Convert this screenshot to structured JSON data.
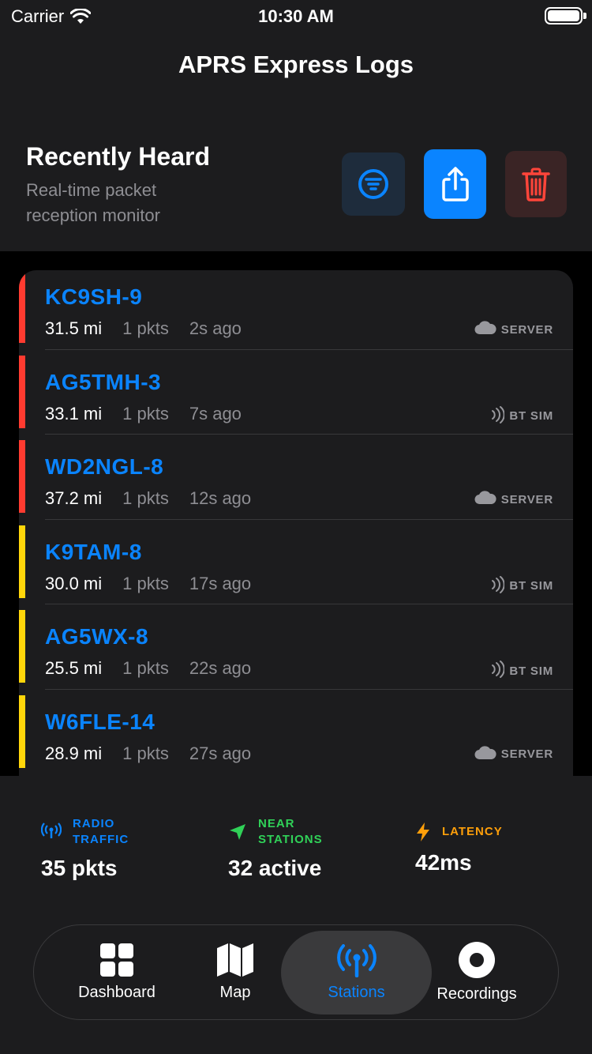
{
  "status_bar": {
    "carrier": "Carrier",
    "time": "10:30 AM"
  },
  "app_title": "APRS Express Logs",
  "section": {
    "title": "Recently Heard",
    "subtitle": "Real-time packet reception monitor"
  },
  "header_buttons": {
    "filter": "filter-icon",
    "share": "share-icon",
    "delete": "trash-icon"
  },
  "colors": {
    "accent": "#0a84ff",
    "red": "#ff3b30",
    "yellow": "#ffd60a",
    "green": "#30d158",
    "orange": "#ff9f0a"
  },
  "stations": [
    {
      "callsign": "KC9SH-9",
      "distance": "31.5 mi",
      "packets": "1 pkts",
      "ago": "2s ago",
      "source": "SERVER",
      "source_icon": "cloud-icon",
      "status_color": "#ff3b30"
    },
    {
      "callsign": "AG5TMH-3",
      "distance": "33.1 mi",
      "packets": "1 pkts",
      "ago": "7s ago",
      "source": "BT SIM",
      "source_icon": "bluetooth-waves-icon",
      "status_color": "#ff3b30"
    },
    {
      "callsign": "WD2NGL-8",
      "distance": "37.2 mi",
      "packets": "1 pkts",
      "ago": "12s ago",
      "source": "SERVER",
      "source_icon": "cloud-icon",
      "status_color": "#ff3b30"
    },
    {
      "callsign": "K9TAM-8",
      "distance": "30.0 mi",
      "packets": "1 pkts",
      "ago": "17s ago",
      "source": "BT SIM",
      "source_icon": "bluetooth-waves-icon",
      "status_color": "#ffd60a"
    },
    {
      "callsign": "AG5WX-8",
      "distance": "25.5 mi",
      "packets": "1 pkts",
      "ago": "22s ago",
      "source": "BT SIM",
      "source_icon": "bluetooth-waves-icon",
      "status_color": "#ffd60a"
    },
    {
      "callsign": "W6FLE-14",
      "distance": "28.9 mi",
      "packets": "1 pkts",
      "ago": "27s ago",
      "source": "SERVER",
      "source_icon": "cloud-icon",
      "status_color": "#ffd60a"
    }
  ],
  "stats": {
    "radio": {
      "label_line1": "RADIO",
      "label_line2": "TRAFFIC",
      "value": "35 pkts",
      "color": "#0a84ff",
      "icon": "antenna-icon"
    },
    "near": {
      "label_line1": "NEAR",
      "label_line2": "STATIONS",
      "value": "32 active",
      "color": "#30d158",
      "icon": "location-arrow-icon"
    },
    "latency": {
      "label": "LATENCY",
      "value": "42ms",
      "color": "#ff9f0a",
      "icon": "bolt-icon"
    }
  },
  "tabs": [
    {
      "label": "Dashboard",
      "icon": "grid-icon",
      "active": false
    },
    {
      "label": "Map",
      "icon": "map-icon",
      "active": false
    },
    {
      "label": "Stations",
      "icon": "antenna-icon",
      "active": true
    },
    {
      "label": "Recordings",
      "icon": "record-icon",
      "active": false
    }
  ]
}
